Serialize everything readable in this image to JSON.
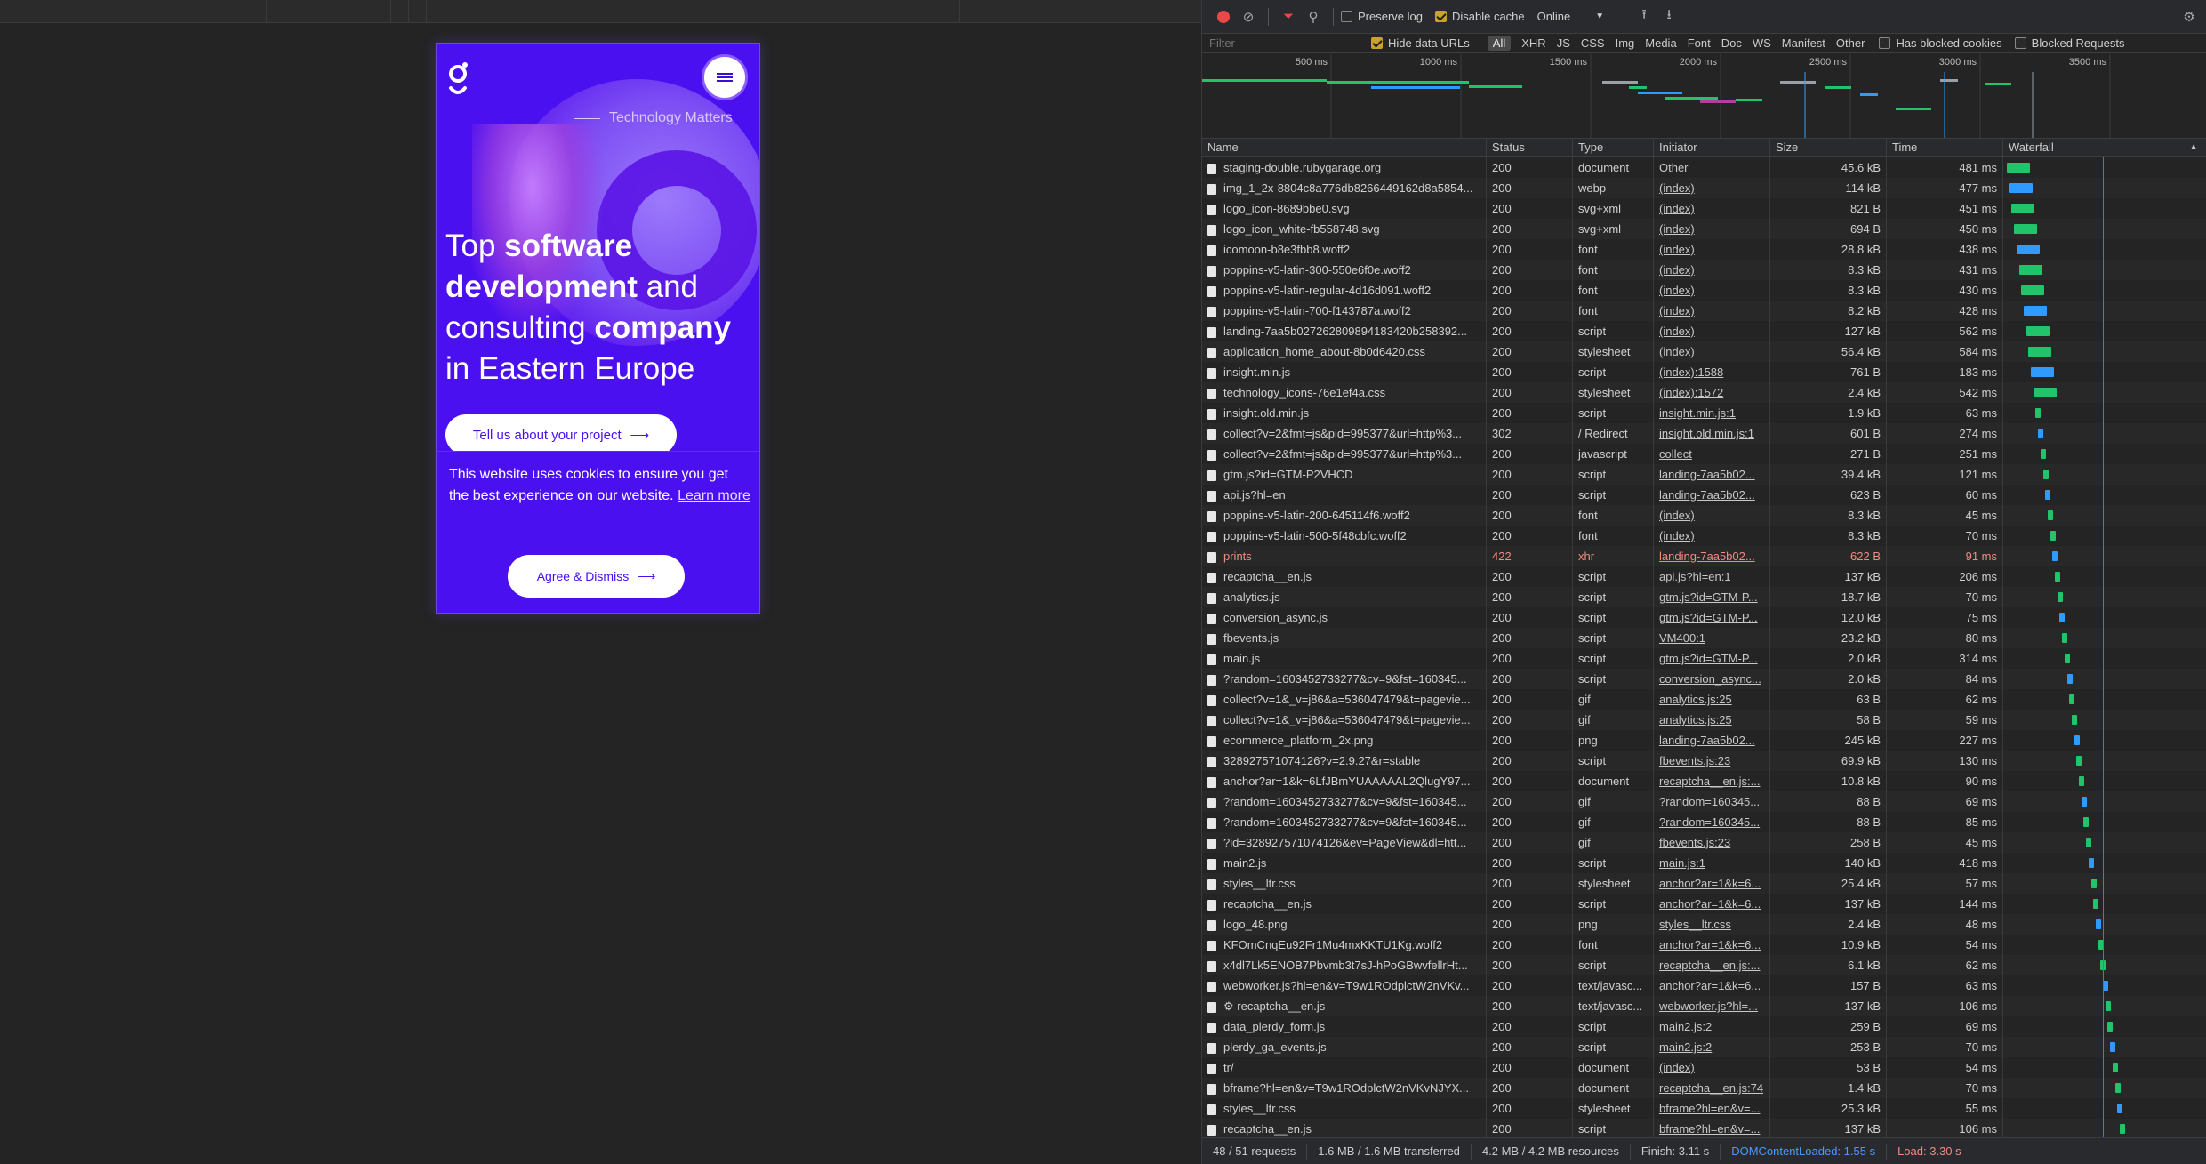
{
  "page": {
    "tagline": "Technology Matters",
    "headline": {
      "t1": "Top ",
      "b1": "software",
      "b2": "development",
      "t2": " and consulting ",
      "b3": "company",
      "t3": " in Eastern Europe"
    },
    "cta_label": "Tell us about your project",
    "cookie_text": "This website uses cookies to ensure you get the best experience on our website.",
    "cookie_link": "Learn more",
    "agree_label": "Agree & Dismiss",
    "brand_color": "#4b10f0"
  },
  "devtools": {
    "preserve_log": "Preserve log",
    "disable_cache": "Disable cache",
    "throttle": "Online",
    "filter_placeholder": "Filter",
    "hide_data_urls": "Hide data URLs",
    "types": [
      "All",
      "XHR",
      "JS",
      "CSS",
      "Img",
      "Media",
      "Font",
      "Doc",
      "WS",
      "Manifest",
      "Other"
    ],
    "has_blocked_cookies": "Has blocked cookies",
    "blocked_requests": "Blocked Requests",
    "ticks": [
      "500 ms",
      "1000 ms",
      "1500 ms",
      "2000 ms",
      "2500 ms",
      "3000 ms",
      "3500 ms"
    ],
    "columns": [
      "Name",
      "Status",
      "Type",
      "Initiator",
      "Size",
      "Time",
      "Waterfall"
    ],
    "rows": [
      [
        "staging-double.rubygarage.org",
        "200",
        "document",
        "Other",
        "45.6 kB",
        "481 ms"
      ],
      [
        "img_1_2x-8804c8a776db8266449162d8a5854...",
        "200",
        "webp",
        "(index)",
        "114 kB",
        "477 ms"
      ],
      [
        "logo_icon-8689bbe0.svg",
        "200",
        "svg+xml",
        "(index)",
        "821 B",
        "451 ms"
      ],
      [
        "logo_icon_white-fb558748.svg",
        "200",
        "svg+xml",
        "(index)",
        "694 B",
        "450 ms"
      ],
      [
        "icomoon-b8e3fbb8.woff2",
        "200",
        "font",
        "(index)",
        "28.8 kB",
        "438 ms"
      ],
      [
        "poppins-v5-latin-300-550e6f0e.woff2",
        "200",
        "font",
        "(index)",
        "8.3 kB",
        "431 ms"
      ],
      [
        "poppins-v5-latin-regular-4d16d091.woff2",
        "200",
        "font",
        "(index)",
        "8.3 kB",
        "430 ms"
      ],
      [
        "poppins-v5-latin-700-f143787a.woff2",
        "200",
        "font",
        "(index)",
        "8.2 kB",
        "428 ms"
      ],
      [
        "landing-7aa5b027262809894183420b258392...",
        "200",
        "script",
        "(index)",
        "127 kB",
        "562 ms"
      ],
      [
        "application_home_about-8b0d6420.css",
        "200",
        "stylesheet",
        "(index)",
        "56.4 kB",
        "584 ms"
      ],
      [
        "insight.min.js",
        "200",
        "script",
        "(index):1588",
        "761 B",
        "183 ms"
      ],
      [
        "technology_icons-76e1ef4a.css",
        "200",
        "stylesheet",
        "(index):1572",
        "2.4 kB",
        "542 ms"
      ],
      [
        "insight.old.min.js",
        "200",
        "script",
        "insight.min.js:1",
        "1.9 kB",
        "63 ms"
      ],
      [
        "collect?v=2&fmt=js&pid=995377&url=http%3...",
        "302",
        "/ Redirect",
        "insight.old.min.js:1",
        "601 B",
        "274 ms"
      ],
      [
        "collect?v=2&fmt=js&pid=995377&url=http%3...",
        "200",
        "javascript",
        "collect",
        "271 B",
        "251 ms"
      ],
      [
        "gtm.js?id=GTM-P2VHCD",
        "200",
        "script",
        "landing-7aa5b02...",
        "39.4 kB",
        "121 ms"
      ],
      [
        "api.js?hl=en",
        "200",
        "script",
        "landing-7aa5b02...",
        "623 B",
        "60 ms"
      ],
      [
        "poppins-v5-latin-200-645114f6.woff2",
        "200",
        "font",
        "(index)",
        "8.3 kB",
        "45 ms"
      ],
      [
        "poppins-v5-latin-500-5f48cbfc.woff2",
        "200",
        "font",
        "(index)",
        "8.3 kB",
        "70 ms"
      ],
      [
        "prints",
        "422",
        "xhr",
        "landing-7aa5b02...",
        "622 B",
        "91 ms"
      ],
      [
        "recaptcha__en.js",
        "200",
        "script",
        "api.js?hl=en:1",
        "137 kB",
        "206 ms"
      ],
      [
        "analytics.js",
        "200",
        "script",
        "gtm.js?id=GTM-P...",
        "18.7 kB",
        "70 ms"
      ],
      [
        "conversion_async.js",
        "200",
        "script",
        "gtm.js?id=GTM-P...",
        "12.0 kB",
        "75 ms"
      ],
      [
        "fbevents.js",
        "200",
        "script",
        "VM400:1",
        "23.2 kB",
        "80 ms"
      ],
      [
        "main.js",
        "200",
        "script",
        "gtm.js?id=GTM-P...",
        "2.0 kB",
        "314 ms"
      ],
      [
        "?random=1603452733277&cv=9&fst=160345...",
        "200",
        "script",
        "conversion_async...",
        "2.0 kB",
        "84 ms"
      ],
      [
        "collect?v=1&_v=j86&a=536047479&t=pagevie...",
        "200",
        "gif",
        "analytics.js:25",
        "63 B",
        "62 ms"
      ],
      [
        "collect?v=1&_v=j86&a=536047479&t=pagevie...",
        "200",
        "gif",
        "analytics.js:25",
        "58 B",
        "59 ms"
      ],
      [
        "ecommerce_platform_2x.png",
        "200",
        "png",
        "landing-7aa5b02...",
        "245 kB",
        "227 ms"
      ],
      [
        "328927571074126?v=2.9.27&r=stable",
        "200",
        "script",
        "fbevents.js:23",
        "69.9 kB",
        "130 ms"
      ],
      [
        "anchor?ar=1&k=6LfJBmYUAAAAAL2QlugY97...",
        "200",
        "document",
        "recaptcha__en.js:...",
        "10.8 kB",
        "90 ms"
      ],
      [
        "?random=1603452733277&cv=9&fst=160345...",
        "200",
        "gif",
        "?random=160345...",
        "88 B",
        "69 ms"
      ],
      [
        "?random=1603452733277&cv=9&fst=160345...",
        "200",
        "gif",
        "?random=160345...",
        "88 B",
        "85 ms"
      ],
      [
        "?id=328927571074126&ev=PageView&dl=htt...",
        "200",
        "gif",
        "fbevents.js:23",
        "258 B",
        "45 ms"
      ],
      [
        "main2.js",
        "200",
        "script",
        "main.js:1",
        "140 kB",
        "418 ms"
      ],
      [
        "styles__ltr.css",
        "200",
        "stylesheet",
        "anchor?ar=1&k=6...",
        "25.4 kB",
        "57 ms"
      ],
      [
        "recaptcha__en.js",
        "200",
        "script",
        "anchor?ar=1&k=6...",
        "137 kB",
        "144 ms"
      ],
      [
        "logo_48.png",
        "200",
        "png",
        "styles__ltr.css",
        "2.4 kB",
        "48 ms"
      ],
      [
        "KFOmCnqEu92Fr1Mu4mxKKTU1Kg.woff2",
        "200",
        "font",
        "anchor?ar=1&k=6...",
        "10.9 kB",
        "54 ms"
      ],
      [
        "x4dl7Lk5ENOB7Pbvmb3t7sJ-hPoGBwvfellrHt...",
        "200",
        "script",
        "recaptcha__en.js:...",
        "6.1 kB",
        "62 ms"
      ],
      [
        "webworker.js?hl=en&v=T9w1ROdplctW2nVKv...",
        "200",
        "text/javasc...",
        "anchor?ar=1&k=6...",
        "157 B",
        "63 ms"
      ],
      [
        "⚙ recaptcha__en.js",
        "200",
        "text/javasc...",
        "webworker.js?hl=...",
        "137 kB",
        "106 ms"
      ],
      [
        "data_plerdy_form.js",
        "200",
        "script",
        "main2.js:2",
        "259 B",
        "69 ms"
      ],
      [
        "plerdy_ga_events.js",
        "200",
        "script",
        "main2.js:2",
        "253 B",
        "70 ms"
      ],
      [
        "tr/",
        "200",
        "document",
        "(index)",
        "53 B",
        "54 ms"
      ],
      [
        "bframe?hl=en&v=T9w1ROdplctW2nVKvNJYX...",
        "200",
        "document",
        "recaptcha__en.js:74",
        "1.4 kB",
        "70 ms"
      ],
      [
        "styles__ltr.css",
        "200",
        "stylesheet",
        "bframe?hl=en&v=...",
        "25.3 kB",
        "55 ms"
      ],
      [
        "recaptcha__en.js",
        "200",
        "script",
        "bframe?hl=en&v=...",
        "137 kB",
        "106 ms"
      ]
    ],
    "status": {
      "requests": "48 / 51 requests",
      "transferred": "1.6 MB / 1.6 MB transferred",
      "resources": "4.2 MB / 4.2 MB resources",
      "finish": "Finish: 3.11 s",
      "dom": "DOMContentLoaded: 1.55 s",
      "load": "Load: 3.30 s"
    }
  }
}
